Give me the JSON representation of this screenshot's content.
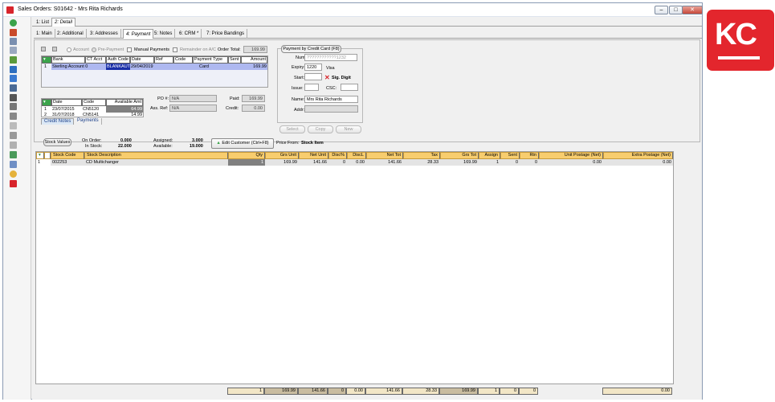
{
  "window": {
    "title": "Sales Orders: S01642 - Mrs Rita Richards",
    "min": "–",
    "max": "□",
    "close": "✕"
  },
  "tabs": [
    "1: List",
    "2: Detail"
  ],
  "subtabs": [
    "1: Main",
    "2: Additional",
    "3: Addresses",
    "4: Payment",
    "5: Notes",
    "6: CRM *",
    "7: Price Bandings"
  ],
  "payment": {
    "account_label": "Account",
    "prepayment_label": "Pre-Payment",
    "manual_payments_label": "Manual Payments",
    "remainder_label": "Remainder on A/C",
    "order_total_label": "Order Total:",
    "order_total": "169.99",
    "grid_headers": [
      "Bank",
      "CT Acct",
      "Auth Code",
      "Date",
      "Ref",
      "Code",
      "Payment Type",
      "Sent",
      "Amount"
    ],
    "row": {
      "num": "1",
      "bank": "Sterling Account 0",
      "auth": "BLANKAUTH",
      "date": "29/04/2019",
      "type": "Card",
      "amount": "169.99"
    },
    "credit_headers": [
      "Date",
      "Code",
      "Available Amt"
    ],
    "credits": [
      {
        "num": "1",
        "date": "23/07/2015",
        "code": "CN5120",
        "amt": "64.99"
      },
      {
        "num": "2",
        "date": "31/07/2018",
        "code": "CN5141",
        "amt": "14.99"
      }
    ],
    "credit_tabs": [
      "Credit Notes",
      "Payments"
    ],
    "po_label": "PO #:",
    "po": "N/A",
    "assref_label": "Ass. Ref:",
    "assref": "N/A",
    "paid_label": "Paid:",
    "paid": "169.99",
    "credit_label": "Credit:",
    "credit": "0.00"
  },
  "card": {
    "title": "Payment by Credit Card (F8)",
    "num_label": "Num:",
    "num": "????????????1232",
    "expiry_label": "Expiry:",
    "expiry": "1220",
    "card_type": "Visa",
    "start_label": "Start:",
    "sig_label": "Sig. Digit",
    "issue_label": "Issue:",
    "csc_label": "CSC:",
    "name_label": "Name:",
    "name": "Mrs Rita Richards",
    "addr_label": "Addr:",
    "buttons": [
      "Select",
      "Copy",
      "New"
    ]
  },
  "summary": {
    "stock_values_label": "Stock Values",
    "on_order_label": "On Order:",
    "on_order": "0.000",
    "in_stock_label": "In Stock:",
    "in_stock": "22.000",
    "assigned_label": "Assigned:",
    "assigned": "3.000",
    "available_label": "Available:",
    "available": "19.000",
    "edit_customer_label": "Edit Customer (Ctrl+F8)",
    "price_from_label": "Price From:",
    "price_from": "Stock Item"
  },
  "lines": {
    "headers": [
      "Stock Code",
      "Stock Description",
      "Qty",
      "Grs Unit",
      "Net Unit",
      "Disc%",
      "DiscL",
      "Net Tot",
      "Tax",
      "Grs Tot",
      "Assign",
      "Sent",
      "Rtn",
      "Unit Postage (Net)",
      "Extra Postage (Net)"
    ],
    "row": {
      "num": "1",
      "code": "002253",
      "desc": "CD Multichanger",
      "qty": "1",
      "grs_unit": "169.99",
      "net_unit": "141.66",
      "disc": "0",
      "discl": "0.00",
      "net_tot": "141.66",
      "tax": "28.33",
      "grs_tot": "169.99",
      "assign": "1",
      "sent": "0",
      "rtn": "0",
      "unit_post": "0.00",
      "extra_post": "0.00"
    },
    "totals": {
      "qty": "1",
      "grs_unit": "169.99",
      "net_unit": "141.66",
      "disc": "0",
      "discl": "0.00",
      "net_tot": "141.66",
      "tax": "28.33",
      "grs_tot": "169.99",
      "assign": "1",
      "sent": "0",
      "rtn": "0",
      "extra_post": "0.00"
    }
  },
  "brand": {
    "logo_text": "KC",
    "color": "#e3262d"
  }
}
